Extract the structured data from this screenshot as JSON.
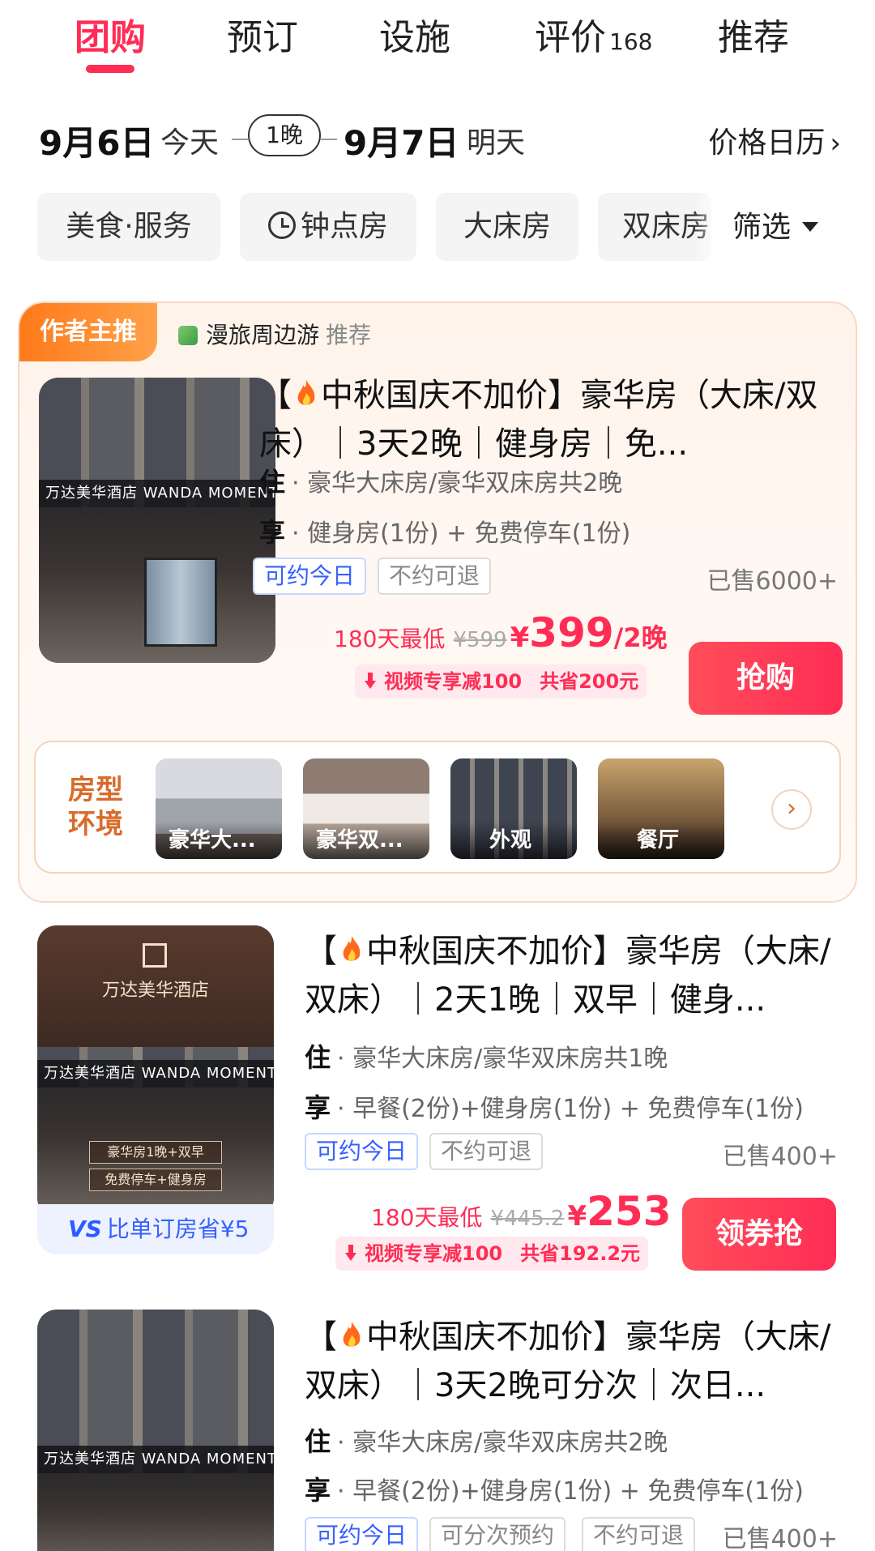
{
  "tabs": [
    {
      "label": "团购",
      "active": true
    },
    {
      "label": "预订"
    },
    {
      "label": "设施"
    },
    {
      "label": "评价",
      "count": "168"
    },
    {
      "label": "推荐"
    }
  ],
  "dates": {
    "checkin": "9月6日",
    "checkin_sub": "今天",
    "nights": "1晚",
    "checkout": "9月7日",
    "checkout_sub": "明天",
    "calendar_link": "价格日历"
  },
  "filters": {
    "chips": [
      "美食·服务",
      "钟点房",
      "大床房",
      "双床房"
    ],
    "more": "筛选"
  },
  "promo": {
    "tag": "作者主推",
    "source": "漫旅周边游",
    "source_suffix": "推荐"
  },
  "deals": [
    {
      "title_prefix": "【",
      "title": "中秋国庆不加价】豪华房（大床/双床）｜3天2晚｜健身房｜免...",
      "stay_key": "住",
      "stay": "· 豪华大床房/豪华双床房共2晚",
      "enjoy_key": "享",
      "enjoy": "· 健身房(1份) + 免费停车(1份)",
      "tags": [
        "可约今日",
        "不约可退"
      ],
      "sold": "已售6000+",
      "price_note": "180天最低",
      "orig_price": "¥599",
      "price_yen": "¥",
      "price": "399",
      "price_unit": "/2晚",
      "discount": "视频专享减100",
      "save": "共省200元",
      "button": "抢购",
      "photo_sign": "万达美华酒店 WANDA MOMENTS"
    },
    {
      "title_prefix": "【",
      "title": "中秋国庆不加价】豪华房（大床/双床）｜2天1晚｜双早｜健身...",
      "stay_key": "住",
      "stay": "· 豪华大床房/豪华双床房共1晚",
      "enjoy_key": "享",
      "enjoy": "· 早餐(2份)+健身房(1份) + 免费停车(1份)",
      "tags": [
        "可约今日",
        "不约可退"
      ],
      "sold": "已售400+",
      "price_note": "180天最低",
      "orig_price": "¥445.2",
      "price_yen": "¥",
      "price": "253",
      "price_unit": "",
      "discount": "视频专享减100",
      "save": "共省192.2元",
      "button": "领券抢",
      "compare_vs": "VS",
      "compare": "比单订房省¥5",
      "photo_brand": "万达美华酒店",
      "photo_sign": "万达美华酒店 WANDA MOMENTS",
      "photo_overlay_1": "豪华房1晚+双早",
      "photo_overlay_2": "免费停车+健身房"
    },
    {
      "title_prefix": "【",
      "title": "中秋国庆不加价】豪华房（大床/双床）｜3天2晚可分次｜次日...",
      "stay_key": "住",
      "stay": "· 豪华大床房/豪华双床房共2晚",
      "enjoy_key": "享",
      "enjoy": "· 早餐(2份)+健身房(1份) + 免费停车(1份)",
      "tags": [
        "可约今日",
        "可分次预约",
        "不约可退"
      ],
      "sold": "已售400+",
      "photo_sign": "万达美华酒店 WANDA MOMENTS"
    }
  ],
  "room_types": {
    "label": "房型环境",
    "items": [
      "豪华大...",
      "豪华双...",
      "外观",
      "餐厅"
    ]
  },
  "colors": {
    "accent": "#ff2d55",
    "promo_orange": "#ff7a1a",
    "tag_blue": "#3561ff"
  }
}
